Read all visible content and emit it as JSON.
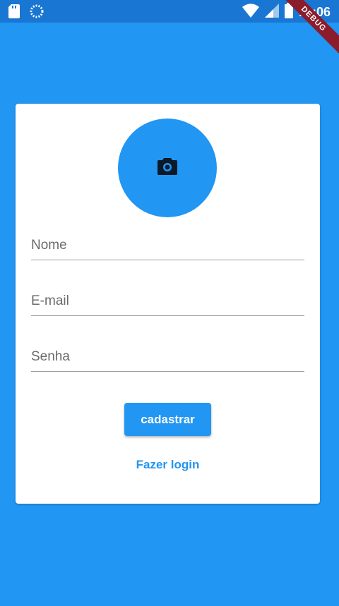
{
  "status_bar": {
    "time": "11:06",
    "icons": [
      "sd-card-icon",
      "sync-icon",
      "wifi-icon",
      "signal-icon",
      "battery-icon"
    ]
  },
  "debug_banner": "DEBUG",
  "form": {
    "avatar_icon": "camera-icon",
    "fields": [
      {
        "placeholder": "Nome",
        "value": ""
      },
      {
        "placeholder": "E-mail",
        "value": ""
      },
      {
        "placeholder": "Senha",
        "value": ""
      }
    ],
    "submit_label": "cadastrar",
    "login_link": "Fazer login"
  },
  "colors": {
    "primary": "#2196F3",
    "status_bar": "#1976D2",
    "card": "#FFFFFF",
    "debug_banner": "#8B1C2B"
  }
}
